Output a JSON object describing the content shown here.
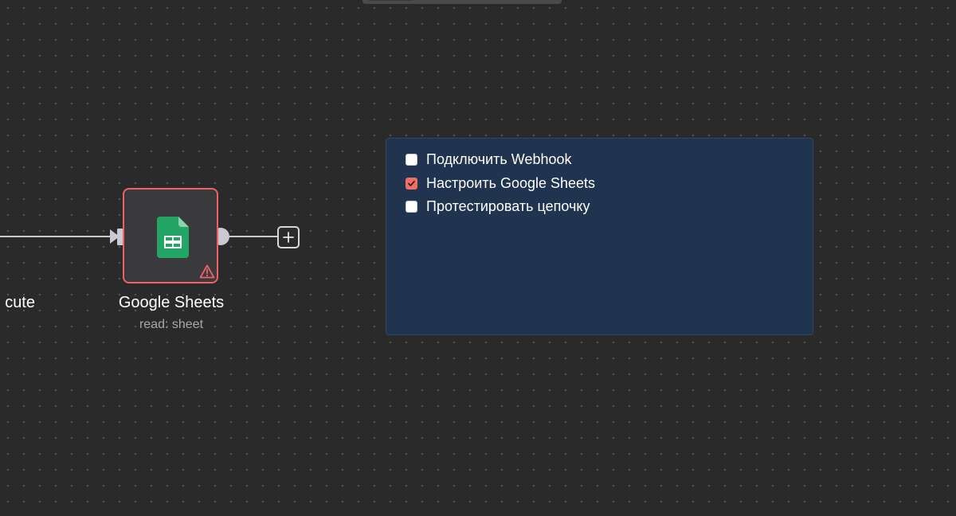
{
  "canvas": {
    "background_color": "#2a2a2a",
    "dot_color": "#5a5a5a"
  },
  "previous_node": {
    "label_fragment": "cute"
  },
  "node": {
    "title": "Google Sheets",
    "subtitle": "read: sheet",
    "icon": "google-sheets-icon",
    "status_icon": "warning-icon",
    "border_color": "#f0606a",
    "status_color": "#f0606a"
  },
  "add_button": {
    "icon": "plus-icon"
  },
  "sticky_note": {
    "background_color": "#20344f",
    "tasks": [
      {
        "label": "Подключить Webhook",
        "checked": false
      },
      {
        "label": "Настроить Google Sheets",
        "checked": true
      },
      {
        "label": "Протестировать цепочку",
        "checked": false
      }
    ],
    "checked_color": "#ef6f62"
  }
}
